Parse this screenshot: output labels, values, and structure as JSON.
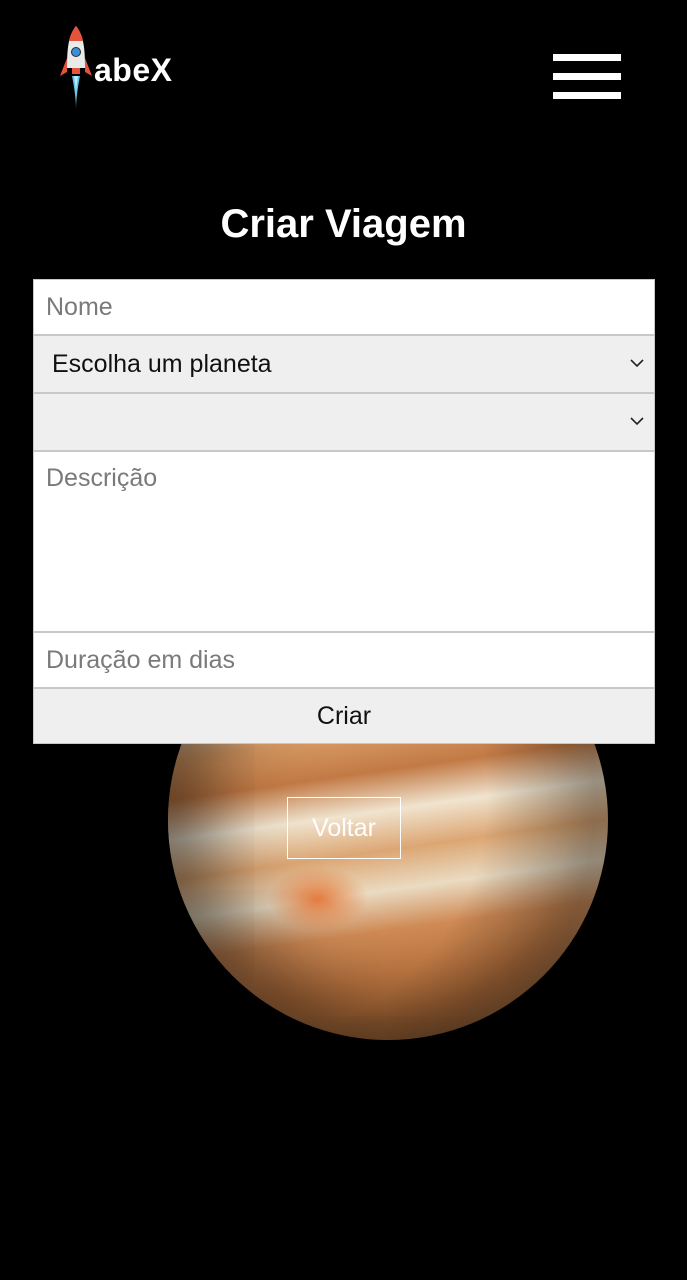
{
  "header": {
    "brand_name": "abeX",
    "logo_icon": "rocket-icon",
    "menu_icon": "hamburger-menu-icon"
  },
  "page": {
    "title": "Criar Viagem"
  },
  "form": {
    "name_placeholder": "Nome",
    "planet_select_value": "Escolha um planeta",
    "second_select_value": "",
    "description_placeholder": "Descrição",
    "duration_placeholder": "Duração em dias",
    "submit_label": "Criar"
  },
  "actions": {
    "back_label": "Voltar"
  },
  "colors": {
    "background": "#000000",
    "field_background": "#ffffff",
    "select_background": "#efefef",
    "text_light": "#ffffff"
  }
}
